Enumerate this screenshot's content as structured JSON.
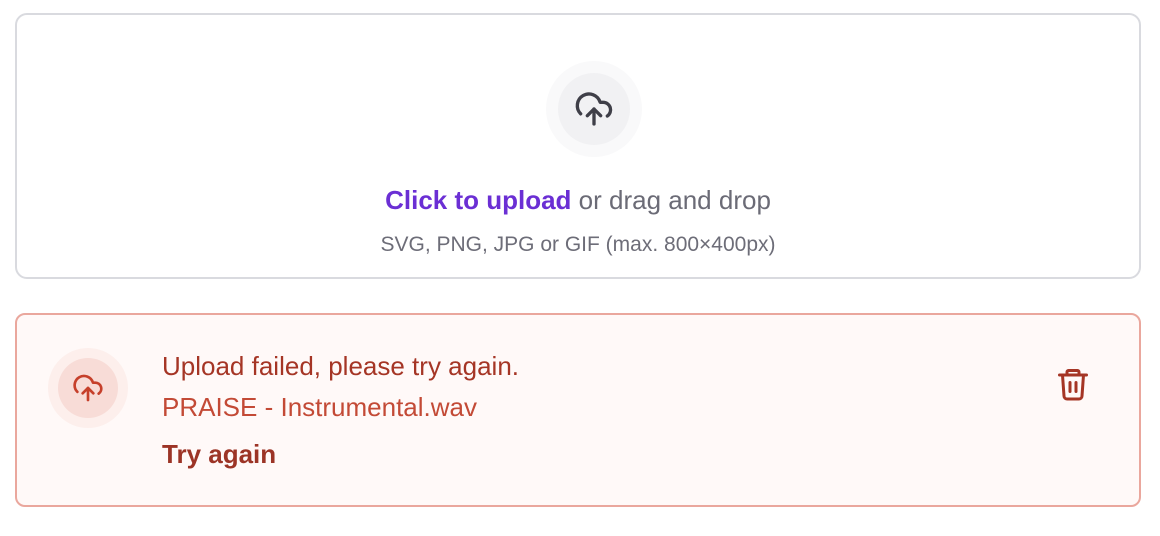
{
  "dropzone": {
    "icon": "cloud-upload-icon",
    "link_label": "Click to upload",
    "rest_label": " or drag and drop",
    "hint": "SVG, PNG, JPG or GIF (max. 800×400px)",
    "accent_color": "#6b2fd4"
  },
  "error_item": {
    "icon": "cloud-upload-icon",
    "title": "Upload failed, please try again.",
    "filename": "PRAISE - Instrumental.wav",
    "action_label": "Try again",
    "delete_icon": "trash-icon",
    "error_color": "#a53525",
    "border_color": "#eaa79d"
  }
}
